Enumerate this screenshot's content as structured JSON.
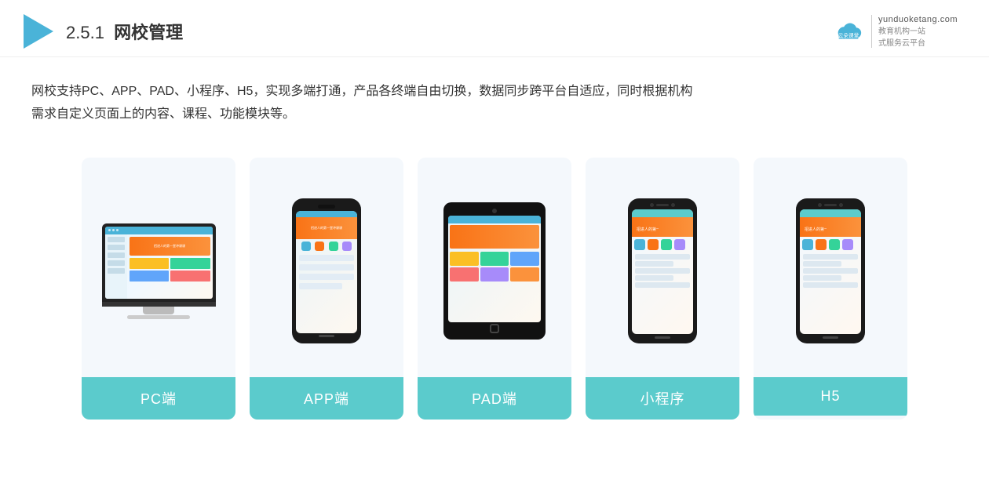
{
  "header": {
    "section_number": "2.5.1",
    "title_plain": "网校管理",
    "brand_url": "yunduoketang.com",
    "brand_tagline1": "教育机构一站",
    "brand_tagline2": "式服务云平台"
  },
  "description": {
    "line1": "网校支持PC、APP、PAD、小程序、H5，实现多端打通，产品各终端自由切换，数据同步跨平台自适应，同时根据机构",
    "line2": "需求自定义页面上的内容、课程、功能模块等。"
  },
  "cards": [
    {
      "id": "pc",
      "label": "PC端"
    },
    {
      "id": "app",
      "label": "APP端"
    },
    {
      "id": "pad",
      "label": "PAD端"
    },
    {
      "id": "miniprogram",
      "label": "小程序"
    },
    {
      "id": "h5",
      "label": "H5"
    }
  ],
  "colors": {
    "card_label_bg": "#5bcbcc",
    "header_accent": "#4ab3d8",
    "orange": "#f97316"
  }
}
